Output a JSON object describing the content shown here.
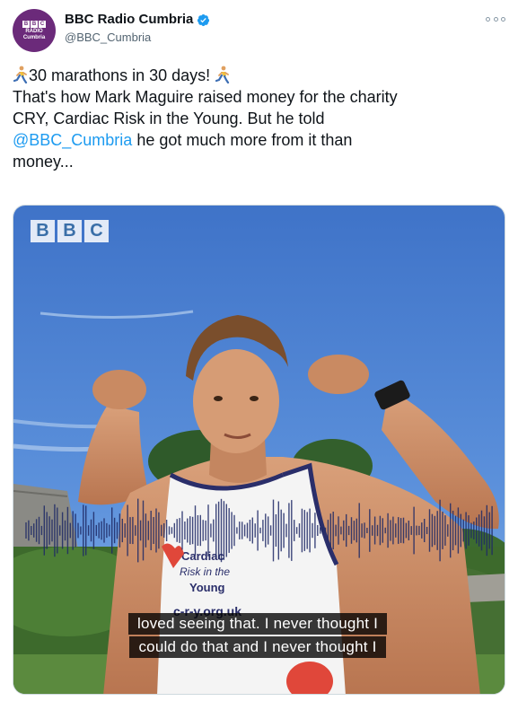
{
  "account": {
    "display_name": "BBC Radio Cumbria",
    "handle": "@BBC_Cumbria",
    "avatar_lines": [
      "RADIO",
      "Cumbria"
    ],
    "avatar_bbc": [
      "B",
      "B",
      "C"
    ]
  },
  "tweet": {
    "line1_text": "30 marathons in 30 days!",
    "line2": "That's how Mark Maguire raised money for the charity",
    "line3": "CRY, Cardiac Risk in the Young. But he told",
    "mention": "@BBC_Cumbria",
    "line4_rest": " he got much more from it than",
    "line5": "money..."
  },
  "media": {
    "bbc_logo": [
      "B",
      "B",
      "C"
    ],
    "caption_line1": "loved seeing that. I never thought I",
    "caption_line2": "could do that and I never thought I",
    "vest_text": [
      "Cardiac",
      "Risk in the",
      "Young",
      "c-r-y.org.uk"
    ]
  },
  "colors": {
    "mention": "#1d9bf0",
    "avatar_bg": "#6b2a7a",
    "waveform": "#1f2a66",
    "verified": "#1d9bf0"
  }
}
